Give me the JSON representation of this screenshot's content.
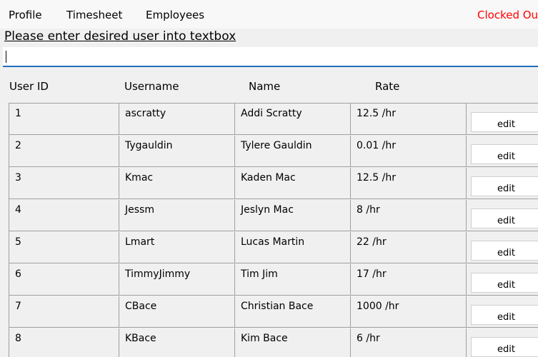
{
  "menu": {
    "items": [
      "Profile",
      "Timesheet",
      "Employees"
    ],
    "status_text": "Clocked Out"
  },
  "prompt": "Please enter desired user into textbox",
  "search": {
    "value": ""
  },
  "table": {
    "headers": [
      "User ID",
      "Username",
      "Name",
      "Rate"
    ],
    "edit_label": "edit",
    "rows": [
      {
        "id": "1",
        "username": "ascratty",
        "name": "Addi Scratty",
        "rate": "12.5 /hr"
      },
      {
        "id": "2",
        "username": "Tygauldin",
        "name": "Tylere Gauldin",
        "rate": "0.01 /hr"
      },
      {
        "id": "3",
        "username": "Kmac",
        "name": "Kaden Mac",
        "rate": "12.5 /hr"
      },
      {
        "id": "4",
        "username": "Jessm",
        "name": "Jeslyn Mac",
        "rate": "8 /hr"
      },
      {
        "id": "5",
        "username": "Lmart",
        "name": "Lucas Martin",
        "rate": "22 /hr"
      },
      {
        "id": "6",
        "username": "TimmyJimmy",
        "name": "Tim Jim",
        "rate": "17 /hr"
      },
      {
        "id": "7",
        "username": "CBace",
        "name": "Christian Bace",
        "rate": "1000 /hr"
      },
      {
        "id": "8",
        "username": "KBace",
        "name": "Kim Bace",
        "rate": "6 /hr"
      }
    ]
  },
  "colors": {
    "status": "#ff0000",
    "input_underline": "#1f6fbf",
    "grid_line": "#a0a0a0"
  }
}
